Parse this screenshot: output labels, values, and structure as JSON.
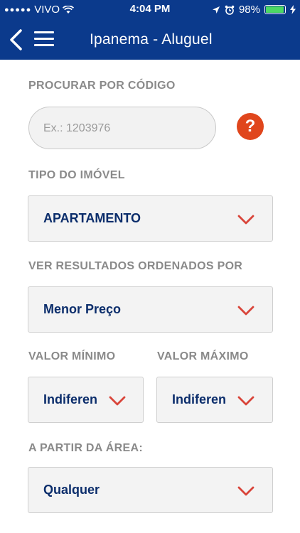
{
  "status_bar": {
    "carrier": "VIVO",
    "time": "4:04 PM",
    "battery": "98%",
    "battery_level": 0.98
  },
  "navbar": {
    "title": "Ipanema - Aluguel",
    "icons": [
      "back-chevron-icon",
      "hamburger-menu-icon"
    ]
  },
  "form": {
    "code_label": "PROCURAR POR CÓDIGO",
    "code_placeholder": "Ex.: 1203976",
    "help_glyph": "?",
    "type_label": "TIPO DO IMÓVEL",
    "type_value": "APARTAMENTO",
    "order_label": "VER RESULTADOS ORDENADOS POR",
    "order_value": "Menor Preço",
    "min_label": "VALOR MÍNIMO",
    "min_value": "Indiferen",
    "max_label": "VALOR MÁXIMO",
    "max_value": "Indiferen",
    "area_label": "A PARTIR DA ÁREA:",
    "area_value": "Qualquer"
  },
  "colors": {
    "brand": "#0b3a8c",
    "accent": "#e0461c",
    "chevron": "#d9453a",
    "value_text": "#0b2d6b"
  }
}
